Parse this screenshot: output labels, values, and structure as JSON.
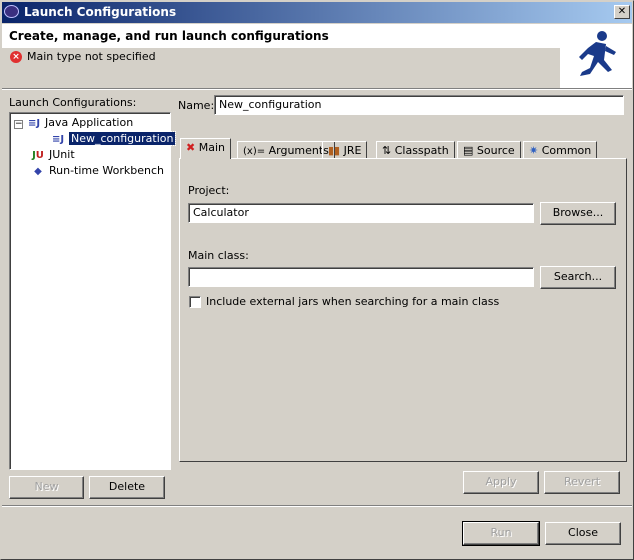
{
  "window": {
    "title": "Launch Configurations",
    "close": "✕"
  },
  "header": {
    "title": "Create, manage, and run launch configurations",
    "error": "Main type not specified"
  },
  "left": {
    "label": "Launch Configurations:",
    "tree": [
      {
        "label": "Java Application",
        "icon": "java-app-icon"
      },
      {
        "label": "New_configuration",
        "icon": "java-config-icon"
      },
      {
        "label": "JUnit",
        "icon": "junit-icon"
      },
      {
        "label": "Run-time Workbench",
        "icon": "workbench-icon"
      }
    ],
    "new": "New",
    "delete": "Delete"
  },
  "name": {
    "label": "Name:",
    "value": "New_configuration"
  },
  "tabs": [
    {
      "label": "Main"
    },
    {
      "label": "Arguments",
      "icon": "(x)="
    },
    {
      "label": "JRE"
    },
    {
      "label": "Classpath",
      "icon": "⇅"
    },
    {
      "label": "Source"
    },
    {
      "label": "Common"
    }
  ],
  "main": {
    "project_label": "Project:",
    "project_value": "Calculator",
    "browse": "Browse...",
    "mainclass_label": "Main class:",
    "mainclass_value": "",
    "search": "Search...",
    "checkbox_label": "Include external jars when searching for a main class",
    "checkbox_checked": false
  },
  "buttons": {
    "apply": "Apply",
    "revert": "Revert",
    "run": "Run",
    "close": "Close"
  }
}
